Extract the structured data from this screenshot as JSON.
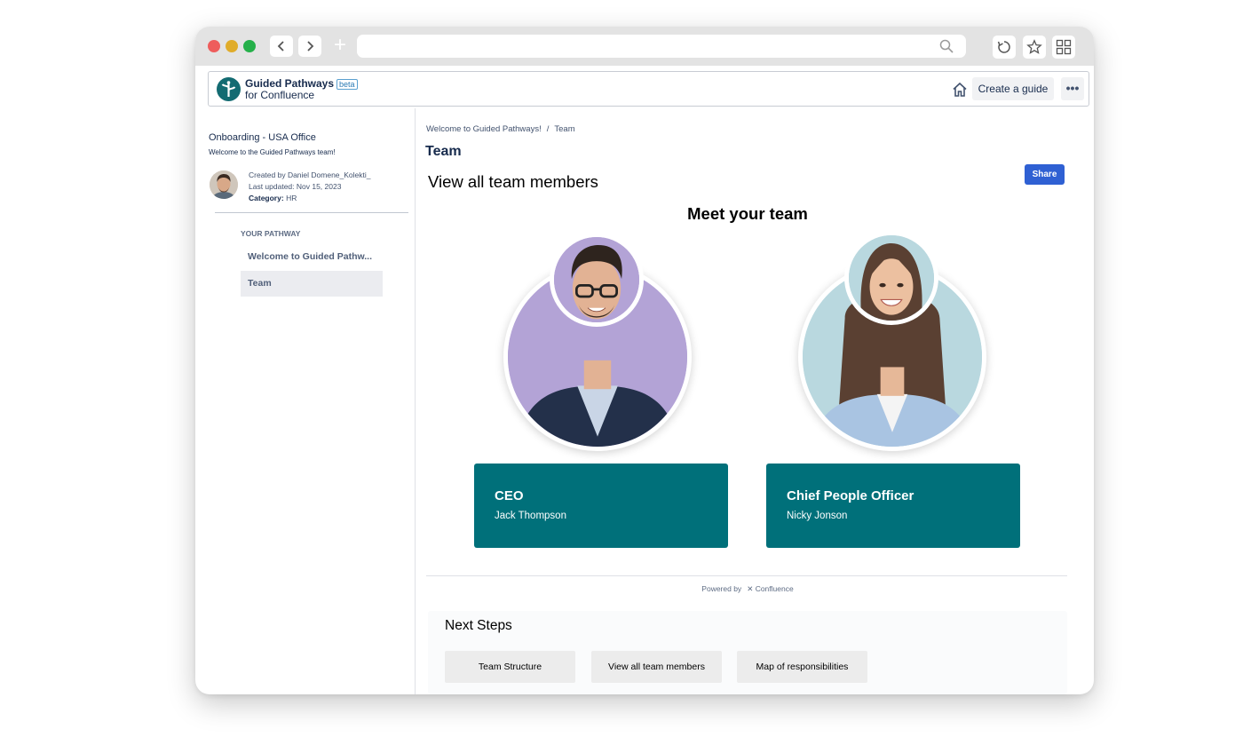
{
  "browser": {
    "url_value": "",
    "icons": {
      "back": "chevron-left-icon",
      "forward": "chevron-right-icon",
      "new_tab": "plus-icon",
      "search": "search-icon",
      "reload": "reload-icon",
      "bookmark": "star-icon",
      "extensions": "grid-icon"
    }
  },
  "header": {
    "brand_line1": "Guided Pathways",
    "badge": "beta",
    "brand_line2": "for Confluence",
    "create_label": "Create a guide",
    "more_label": "•••"
  },
  "sidebar": {
    "title": "Onboarding - USA Office",
    "subtitle": "Welcome to the Guided Pathways team!",
    "created_by": "Created by Daniel Domene_Kolekti_",
    "last_updated": "Last updated: Nov 15, 2023",
    "category_label": "Category:",
    "category_value": "HR",
    "section_label": "YOUR PATHWAY",
    "items": [
      {
        "label": "Welcome to Guided Pathw..."
      },
      {
        "label": "Team"
      }
    ]
  },
  "main": {
    "breadcrumb": [
      "Welcome to Guided Pathways!",
      "Team"
    ],
    "breadcrumb_sep": "/",
    "page_title": "Team",
    "share_label": "Share",
    "subheading": "View all team members",
    "section_title": "Meet your team",
    "members": [
      {
        "role": "CEO",
        "name": "Jack Thompson"
      },
      {
        "role": "Chief People Officer",
        "name": "Nicky Jonson"
      }
    ],
    "powered_by": "Powered by",
    "powered_brand": "Confluence",
    "next_steps": {
      "title": "Next Steps",
      "buttons": [
        "Team Structure",
        "View all team members",
        "Map of responsibilities"
      ]
    }
  },
  "colors": {
    "card_teal": "#00707a",
    "share_blue": "#2f60d3",
    "logo_teal": "#136b72",
    "ceo_bg": "#b3a3d6",
    "cpo_bg": "#b9d8df"
  }
}
